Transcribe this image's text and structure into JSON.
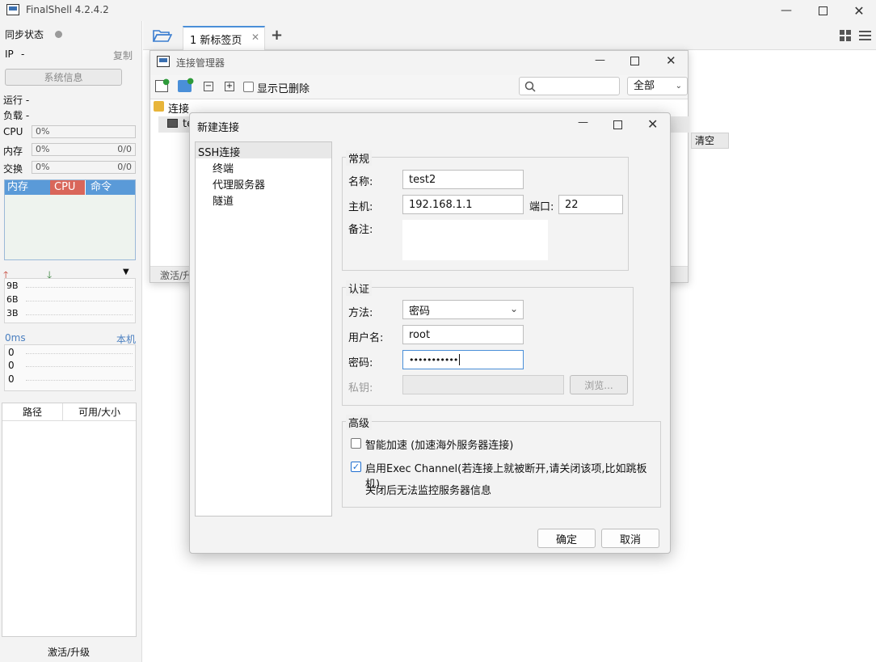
{
  "app": {
    "title": "FinalShell 4.2.4.2"
  },
  "left": {
    "sync_label": "同步状态",
    "ip_label": "IP",
    "ip_value": "-",
    "copy_label": "复制",
    "sysinfo_label": "系统信息",
    "run_label": "运行 -",
    "load_label": "负载 -",
    "cpu_label": "CPU",
    "cpu_value": "0%",
    "mem_label": "内存",
    "mem_value": "0%",
    "mem_right": "0/0",
    "swap_label": "交换",
    "swap_value": "0%",
    "swap_right": "0/0",
    "proc_tabs": [
      "内存",
      "CPU",
      "命令"
    ],
    "net_ticks": [
      "9B",
      "6B",
      "3B"
    ],
    "ping_label": "0ms",
    "ping_host": "本机",
    "ping_vals": [
      "0",
      "0",
      "0"
    ],
    "disk_headers": [
      "路径",
      "可用/大小"
    ],
    "activate_label": "激活/升级"
  },
  "tabs": {
    "active_label": "1 新标签页"
  },
  "conn_mgr": {
    "title": "连接管理器",
    "show_deleted": "显示已删除",
    "filter_value": "全部",
    "tree_root": "连接",
    "tree_child": "te",
    "clear_label": "清空",
    "status": "激活/升"
  },
  "dialog": {
    "title": "新建连接",
    "nav": [
      "SSH连接",
      "终端",
      "代理服务器",
      "隧道"
    ],
    "general": {
      "title": "常规",
      "name_label": "名称:",
      "name_value": "test2",
      "host_label": "主机:",
      "host_value": "192.168.1.1",
      "port_label": "端口:",
      "port_value": "22",
      "note_label": "备注:"
    },
    "auth": {
      "title": "认证",
      "method_label": "方法:",
      "method_value": "密码",
      "user_label": "用户名:",
      "user_value": "root",
      "pwd_label": "密码:",
      "pwd_value": "•••••••••••",
      "key_label": "私钥:",
      "browse_label": "浏览..."
    },
    "advanced": {
      "title": "高级",
      "accel_label": "智能加速 (加速海外服务器连接)",
      "exec_label": "启用Exec Channel(若连接上就被断开,请关闭该项,比如跳板机)",
      "exec_note": "关闭后无法监控服务器信息"
    },
    "ok_label": "确定",
    "cancel_label": "取消"
  },
  "colors": {
    "accent": "#4a8fd8",
    "cpu_tab": "#d9665a",
    "mem_tab": "#5a9ad8",
    "check": "#1f6fd0"
  }
}
